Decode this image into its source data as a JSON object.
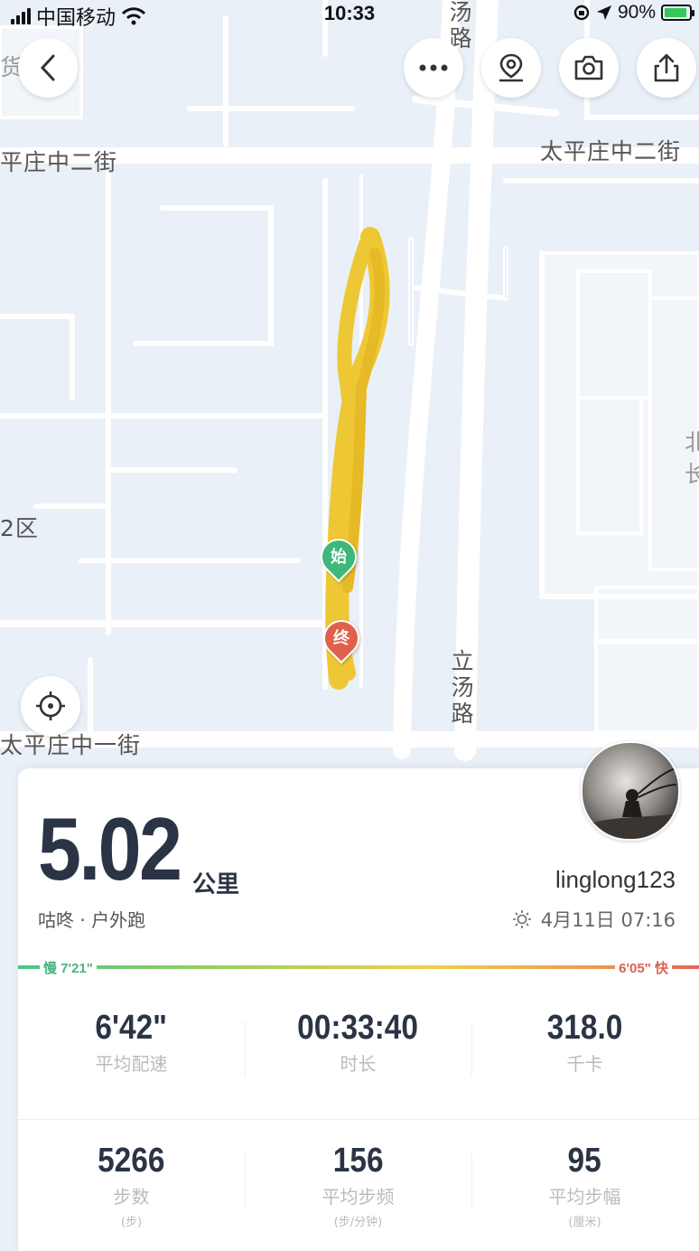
{
  "status_bar": {
    "carrier": "中国移动",
    "time": "10:33",
    "battery_percent": "90%"
  },
  "map": {
    "labels": {
      "top_road": "汤路",
      "left_street": "平庄中二街",
      "right_street": "太平庄中二街",
      "district": "2区",
      "bottom_street": "太平庄中一街",
      "road": "立汤路",
      "left_top": "货",
      "right_edge_char": "北",
      "right_edge_char2": "长"
    },
    "start_marker": "始",
    "end_marker": "终"
  },
  "toolbar": {
    "back_icon": "chevron-left-icon",
    "more_icon": "more-icon",
    "location_icon": "map-pin-icon",
    "camera_icon": "camera-icon",
    "share_icon": "share-icon",
    "recenter_icon": "crosshair-icon"
  },
  "summary": {
    "distance": "5.02",
    "unit": "公里",
    "subtitle": "咕咚 · 户外跑",
    "username": "linglong123",
    "datetime": "4月11日 07:16",
    "weather_icon": "sun-icon"
  },
  "pace": {
    "slow_label": "慢 7'21\"",
    "fast_label": "6'05\" 快",
    "colors": [
      "#4cc58a",
      "#f0d04d",
      "#e3665a"
    ]
  },
  "stats_row1": [
    {
      "value": "6'42\"",
      "label": "平均配速"
    },
    {
      "value": "00:33:40",
      "label": "时长"
    },
    {
      "value": "318.0",
      "label": "千卡"
    }
  ],
  "stats_row2": [
    {
      "value": "5266",
      "label": "步数",
      "unit": "(步)"
    },
    {
      "value": "156",
      "label": "平均步频",
      "unit": "(步/分钟)"
    },
    {
      "value": "95",
      "label": "平均步幅",
      "unit": "(厘米)"
    }
  ],
  "route_color": "#f0c419"
}
